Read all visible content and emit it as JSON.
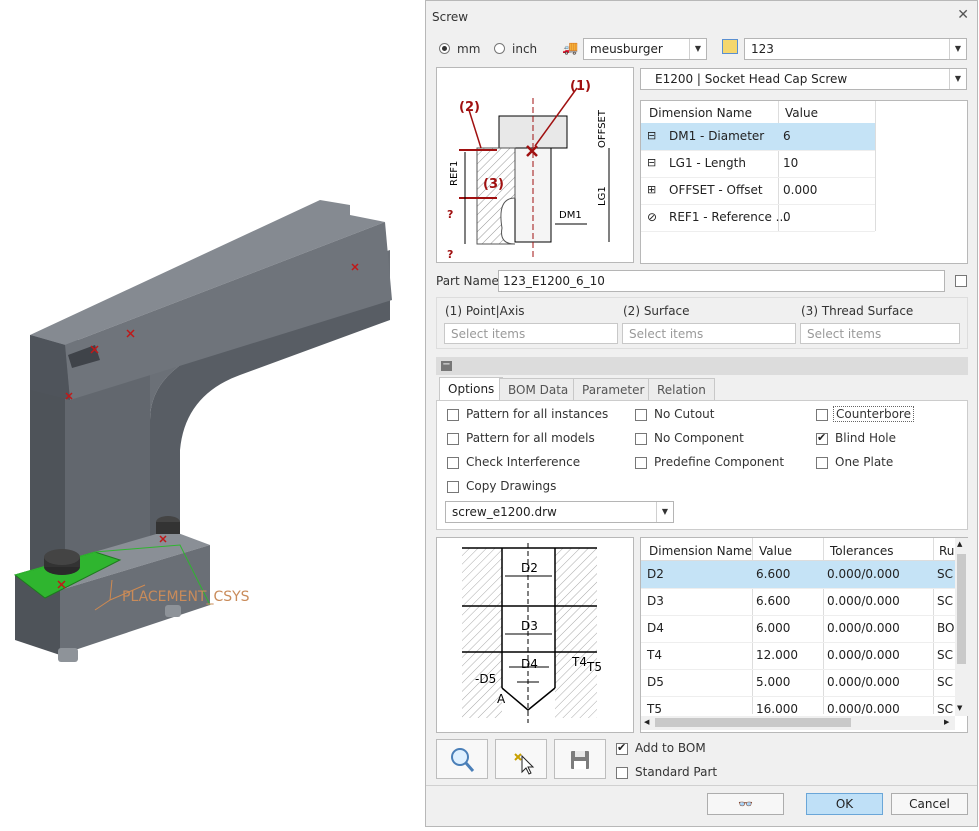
{
  "viewport": {
    "csys_label": "PLACEMENT_CSYS"
  },
  "dialog": {
    "title": "Screw",
    "units": [
      {
        "label": "mm",
        "selected": true
      },
      {
        "label": "inch",
        "selected": false
      }
    ],
    "supplier": "meusburger",
    "catalog": "123",
    "screw_type": "E1200 | Socket Head Cap Screw",
    "diagram_labels": {
      "p1": "(1)",
      "p2": "(2)",
      "p3": "(3)",
      "offset": "OFFSET",
      "ref1": "REF1",
      "lg1": "LG1",
      "dm1": "DM1",
      "q1": "?",
      "q2": "?"
    },
    "dim_table": {
      "headers": [
        "Dimension Name",
        "Value"
      ],
      "rows": [
        {
          "name": "DM1 - Diameter",
          "value": "6",
          "icon": "diameter-icon",
          "selected": true
        },
        {
          "name": "LG1 - Length",
          "value": "10",
          "icon": "length-icon",
          "selected": false
        },
        {
          "name": "OFFSET - Offset",
          "value": "0.000",
          "icon": "offset-icon",
          "selected": false
        },
        {
          "name": "REF1 - Reference ...",
          "value": "0",
          "icon": "reference-icon",
          "selected": false
        }
      ]
    },
    "part_name_label": "Part Name",
    "part_name_value": "123_E1200_6_10",
    "refs": [
      {
        "label": "(1) Point|Axis",
        "placeholder": "Select items"
      },
      {
        "label": "(2) Surface",
        "placeholder": "Select items"
      },
      {
        "label": "(3) Thread Surface",
        "placeholder": "Select items"
      }
    ],
    "tabs": [
      "Options",
      "BOM Data",
      "Parameter",
      "Relation"
    ],
    "options": [
      {
        "label": "Pattern for all instances",
        "checked": false
      },
      {
        "label": "No Cutout",
        "checked": false
      },
      {
        "label": "Counterbore",
        "checked": false
      },
      {
        "label": "Pattern for all models",
        "checked": false
      },
      {
        "label": "No Component",
        "checked": false
      },
      {
        "label": "Blind Hole",
        "checked": true
      },
      {
        "label": "Check Interference",
        "checked": false
      },
      {
        "label": "Predefine Component",
        "checked": false
      },
      {
        "label": "One Plate",
        "checked": false
      },
      {
        "label": "Copy Drawings",
        "checked": false
      }
    ],
    "drawing_file": "screw_e1200.drw",
    "hole_labels": {
      "d2": "D2",
      "d3": "D3",
      "d4": "D4",
      "d5": "-D5",
      "t4": "T4",
      "t5": "T5",
      "a": "A"
    },
    "hole_table": {
      "headers": [
        "Dimension Name",
        "Value",
        "Tolerances",
        "Rule"
      ],
      "rows": [
        {
          "name": "D2",
          "value": "6.600",
          "tol": "0.000/0.000",
          "rule": "SC",
          "selected": true
        },
        {
          "name": "D3",
          "value": "6.600",
          "tol": "0.000/0.000",
          "rule": "SC",
          "selected": false
        },
        {
          "name": "D4",
          "value": "6.000",
          "tol": "0.000/0.000",
          "rule": "BO",
          "selected": false
        },
        {
          "name": "T4",
          "value": "12.000",
          "tol": "0.000/0.000",
          "rule": "SC",
          "selected": false
        },
        {
          "name": "D5",
          "value": "5.000",
          "tol": "0.000/0.000",
          "rule": "SC",
          "selected": false
        },
        {
          "name": "T5",
          "value": "16.000",
          "tol": "0.000/0.000",
          "rule": "SC",
          "selected": false
        }
      ]
    },
    "add_to_bom": {
      "label": "Add to BOM",
      "checked": true
    },
    "standard_part": {
      "label": "Standard Part",
      "checked": false
    },
    "buttons": {
      "preview": "👓",
      "ok": "OK",
      "cancel": "Cancel"
    },
    "colors": {
      "selection": "#c5e3f6",
      "accent_red": "#a01010",
      "model_gray": "#5b6068",
      "green": "#2fb52f"
    }
  }
}
